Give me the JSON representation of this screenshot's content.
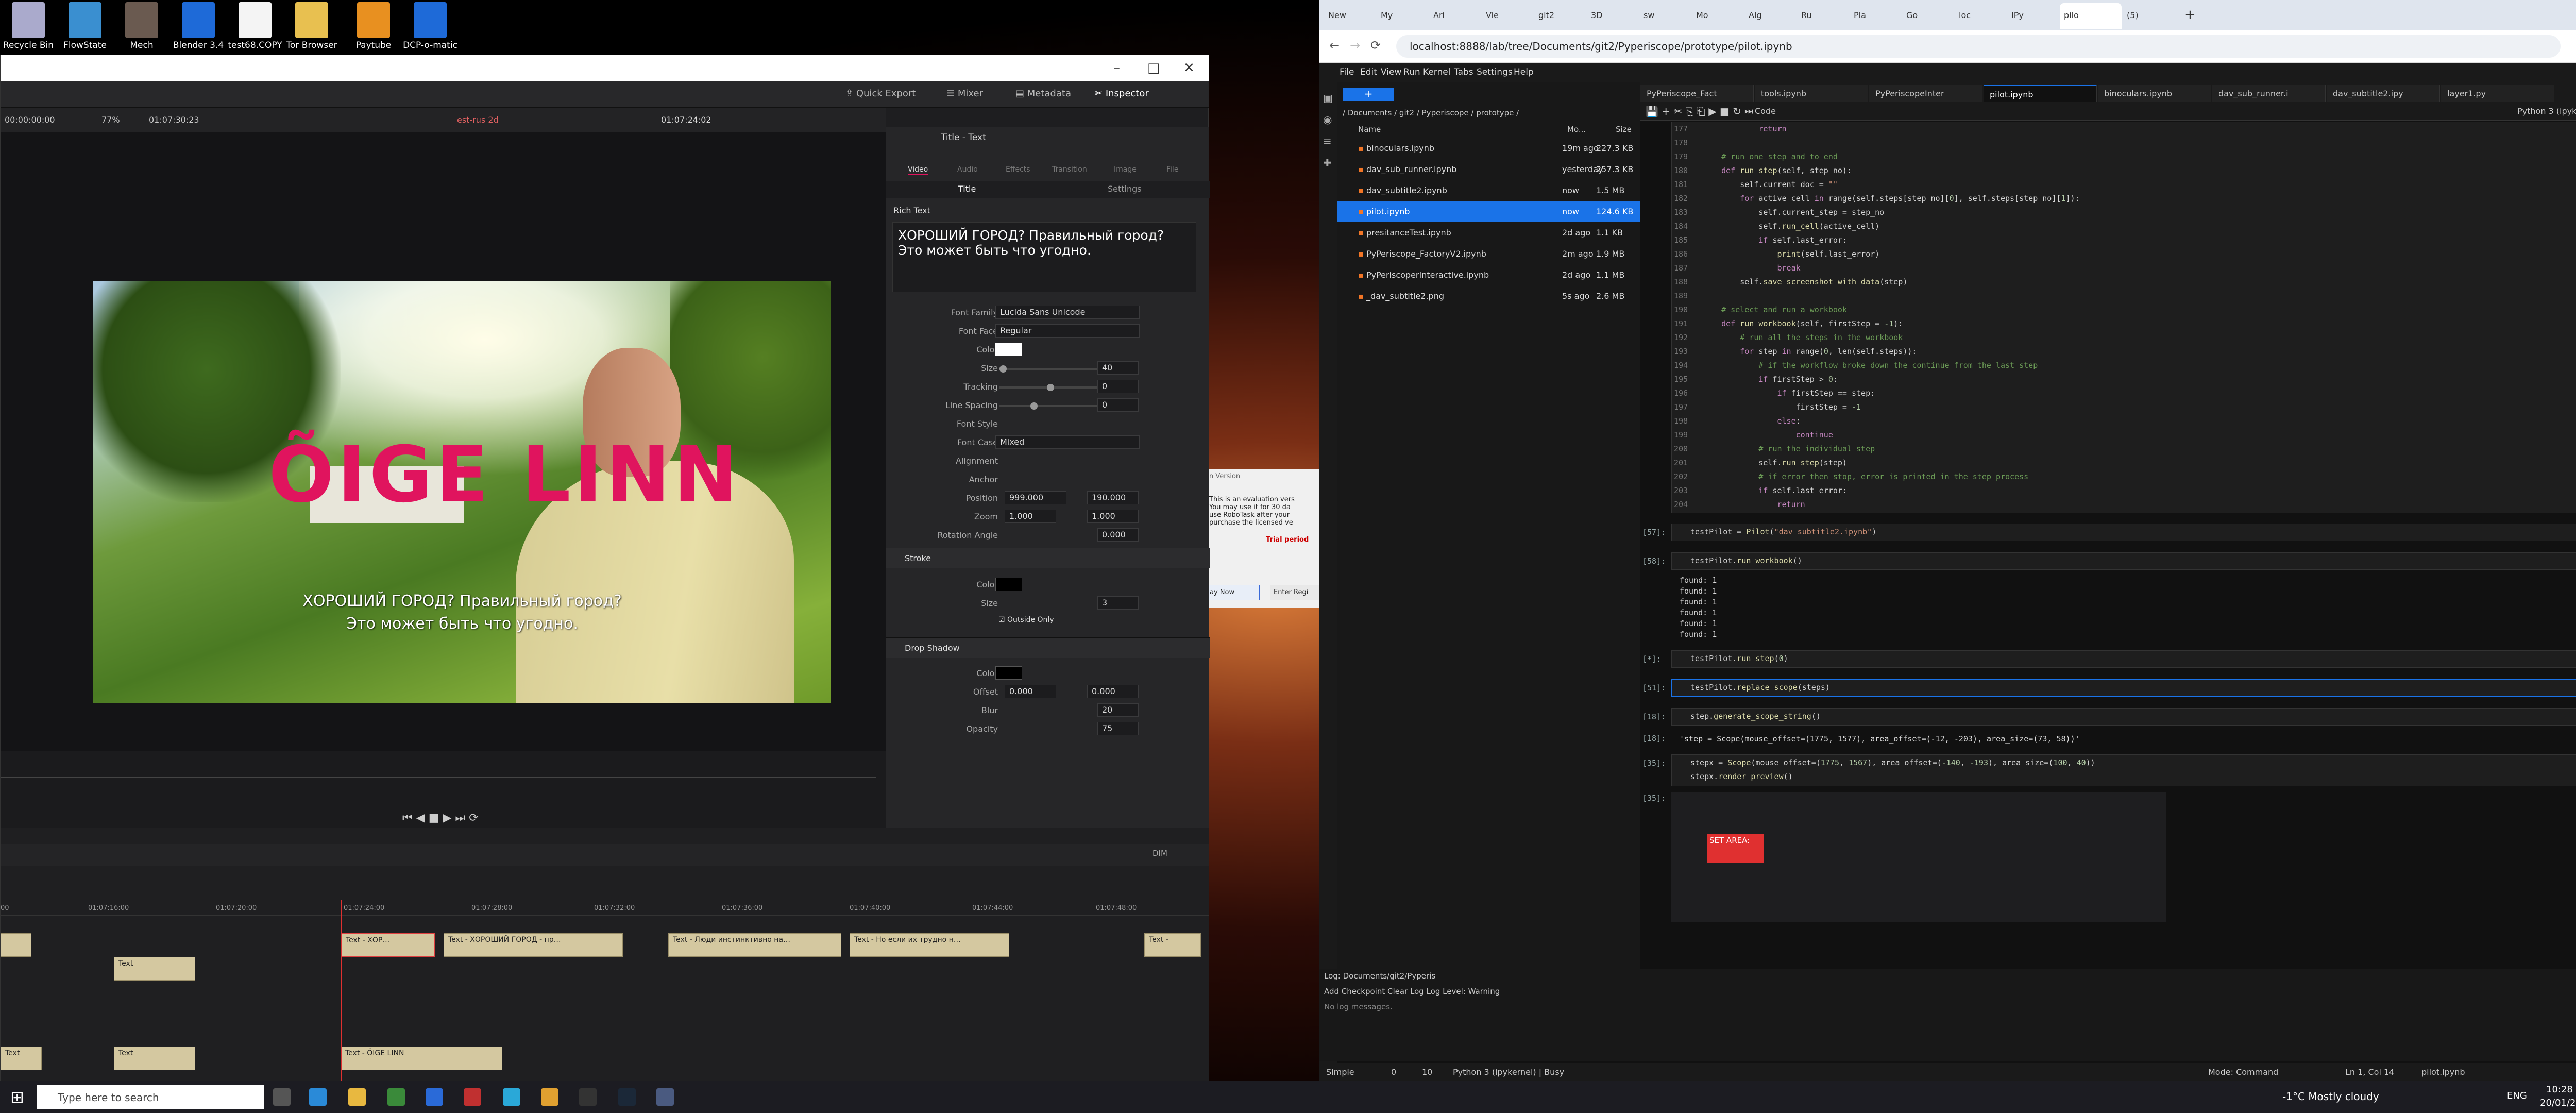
{
  "desktop": {
    "icons": [
      "Recycle Bin",
      "FlowState",
      "Mech",
      "Blender 3.4",
      "test68.COPY",
      "Tor Browser",
      "Paytube",
      "DCP-o-matic"
    ]
  },
  "resolve": {
    "toolbar": {
      "quick_export": "Quick Export",
      "mixer": "Mixer",
      "metadata": "Metadata",
      "inspector": "Inspector"
    },
    "viewer": {
      "timecode_left": "00:00:00:00",
      "zoom": "77%",
      "duration": "01:07:30:23",
      "timeline_name": "est-rus 2d",
      "timecode_right": "01:07:24:02"
    },
    "overlay_title": "ÕIGE LINN",
    "subtitle_lines": [
      "ХОРОШИЙ ГОРОД? Правильный город?",
      "Это может быть что угодно."
    ],
    "inspector": {
      "header": "Title - Text",
      "tabs": [
        "Video",
        "Audio",
        "Effects",
        "Transition",
        "Image",
        "File"
      ],
      "subtabs": {
        "title": "Title",
        "settings": "Settings"
      },
      "rich_text_label": "Rich Text",
      "rich_text": [
        "ХОРОШИЙ ГОРОД? Правильный город?",
        "Это может быть что угодно."
      ],
      "font_family_label": "Font Family",
      "font_family": "Lucida Sans Unicode",
      "font_face_label": "Font Face",
      "font_face": "Regular",
      "color_label": "Color",
      "size_label": "Size",
      "size": "40",
      "tracking_label": "Tracking",
      "tracking": "0",
      "line_spacing_label": "Line Spacing",
      "line_spacing": "0",
      "font_style_label": "Font Style",
      "font_case_label": "Font Case",
      "font_case": "Mixed",
      "alignment_label": "Alignment",
      "anchor_label": "Anchor",
      "position_label": "Position",
      "pos_x": "999.000",
      "pos_y": "190.000",
      "zoom_label": "Zoom",
      "zoom_x": "1.000",
      "zoom_y": "1.000",
      "rotation_label": "Rotation Angle",
      "rotation": "0.000",
      "stroke_label": "Stroke",
      "stroke_color_label": "Color",
      "stroke_size_label": "Size",
      "stroke_size": "3",
      "outside_only": "Outside Only",
      "drop_shadow_label": "Drop Shadow",
      "ds_color_label": "Color",
      "offset_label": "Offset",
      "offset_x": "0.000",
      "offset_y": "0.000",
      "blur_label": "Blur",
      "blur": "20",
      "opacity_label": "Opacity",
      "opacity": "75"
    },
    "dialog": {
      "title": "n Version",
      "lines": [
        "This is an evaluation vers",
        "You may use it for 30 da",
        "use RoboTask after your",
        "purchase the licensed ve"
      ],
      "trial": "Trial period",
      "btn_now": "ay Now",
      "btn_register": "Enter Regi"
    },
    "timeline": {
      "dim": "DIM",
      "ruler": [
        "00",
        "01:07:16:00",
        "01:07:20:00",
        "01:07:24:00",
        "01:07:28:00",
        "01:07:32:00",
        "01:07:36:00",
        "01:07:40:00",
        "01:07:44:00",
        "01:07:48:00"
      ],
      "clips_track2": [
        "Text - ХОР…",
        "Text - ХОРОШИЙ ГОРОД - пр…",
        "Text - Люди инстинктивно на…",
        "Text - Но если их трудно н…",
        "Text -"
      ],
      "clips_track1": [
        "Text",
        "Text",
        "Text - ÕIGE LINN",
        "Text"
      ]
    }
  },
  "chrome": {
    "tabs": [
      "New",
      "My",
      "Ari",
      "Vie",
      "git2",
      "3D",
      "sw",
      "Mo",
      "Alg",
      "Ru",
      "Pla",
      "Go",
      "loc",
      "IPy",
      "pilo",
      "(5)"
    ],
    "url": "localhost:8888/lab/tree/Documents/git2/Pyperiscope/prototype/pilot.ipynb"
  },
  "jupyter": {
    "menu": [
      "File",
      "Edit",
      "View",
      "Run",
      "Kernel",
      "Tabs",
      "Settings",
      "Help"
    ],
    "breadcrumb": "/ Documents / git2 / Pyperiscope / prototype /",
    "file_header": {
      "name": "Name",
      "modified": "Mo...",
      "size": "Size"
    },
    "files": [
      {
        "name": "binoculars.ipynb",
        "mod": "19m ago",
        "size": "227.3 KB"
      },
      {
        "name": "dav_sub_runner.ipynb",
        "mod": "yesterday",
        "size": "257.3 KB"
      },
      {
        "name": "dav_subtitle2.ipynb",
        "mod": "now",
        "size": "1.5 MB"
      },
      {
        "name": "pilot.ipynb",
        "mod": "now",
        "size": "124.6 KB"
      },
      {
        "name": "presitanceTest.ipynb",
        "mod": "2d ago",
        "size": "1.1 KB"
      },
      {
        "name": "PyPeriscope_FactoryV2.ipynb",
        "mod": "2m ago",
        "size": "1.9 MB"
      },
      {
        "name": "PyPeriscoperInteractive.ipynb",
        "mod": "2d ago",
        "size": "1.1 MB"
      },
      {
        "name": "_dav_subtitle2.png",
        "mod": "5s ago",
        "size": "2.6 MB"
      }
    ],
    "nbtabs": [
      "PyPeriscope_Fact",
      "tools.ipynb",
      "PyPeriscopeInter",
      "pilot.ipynb",
      "binoculars.ipynb",
      "dav_sub_runner.i",
      "dav_subtitle2.ipy",
      "layer1.py"
    ],
    "kernel": "Python 3 (ipykernel)",
    "celltype": "Code",
    "prompts": {
      "p57": "[57]:",
      "p58": "[58]:",
      "pstar": "[*]:",
      "p51": "[51]:",
      "p18": "[18]:",
      "p18o": "[18]:",
      "p35": "[35]:",
      "p35o": "[35]:"
    },
    "found_lines": [
      "found: 1",
      "found: 1",
      "found: 1",
      "found: 1",
      "found: 1",
      "found: 1"
    ],
    "out18": "'step = Scope(mouse_offset=(1775, 1577), area_offset=(-12, -203), area_size=(73, 58))'",
    "set_area": "SET AREA:",
    "log_tab": "Log: Documents/git2/Pyperis",
    "add_checkpoint": "Add Checkpoint",
    "clear_log": "Clear Log",
    "log_level_label": "Log Level:",
    "log_level": "Warning",
    "no_log": "No log messages.",
    "status": {
      "mode_simple": "Simple",
      "n1": "0",
      "n2": "10",
      "kernel_status": "Python 3 (ipykernel) | Busy",
      "mode": "Mode: Command",
      "pos": "Ln 1, Col 14",
      "file": "pilot.ipynb"
    }
  },
  "taskbar": {
    "search": "Type here to search",
    "weather": "-1°C  Mostly cloudy",
    "lang": "ENG",
    "time": "10:28",
    "date": "20/01/2025"
  }
}
